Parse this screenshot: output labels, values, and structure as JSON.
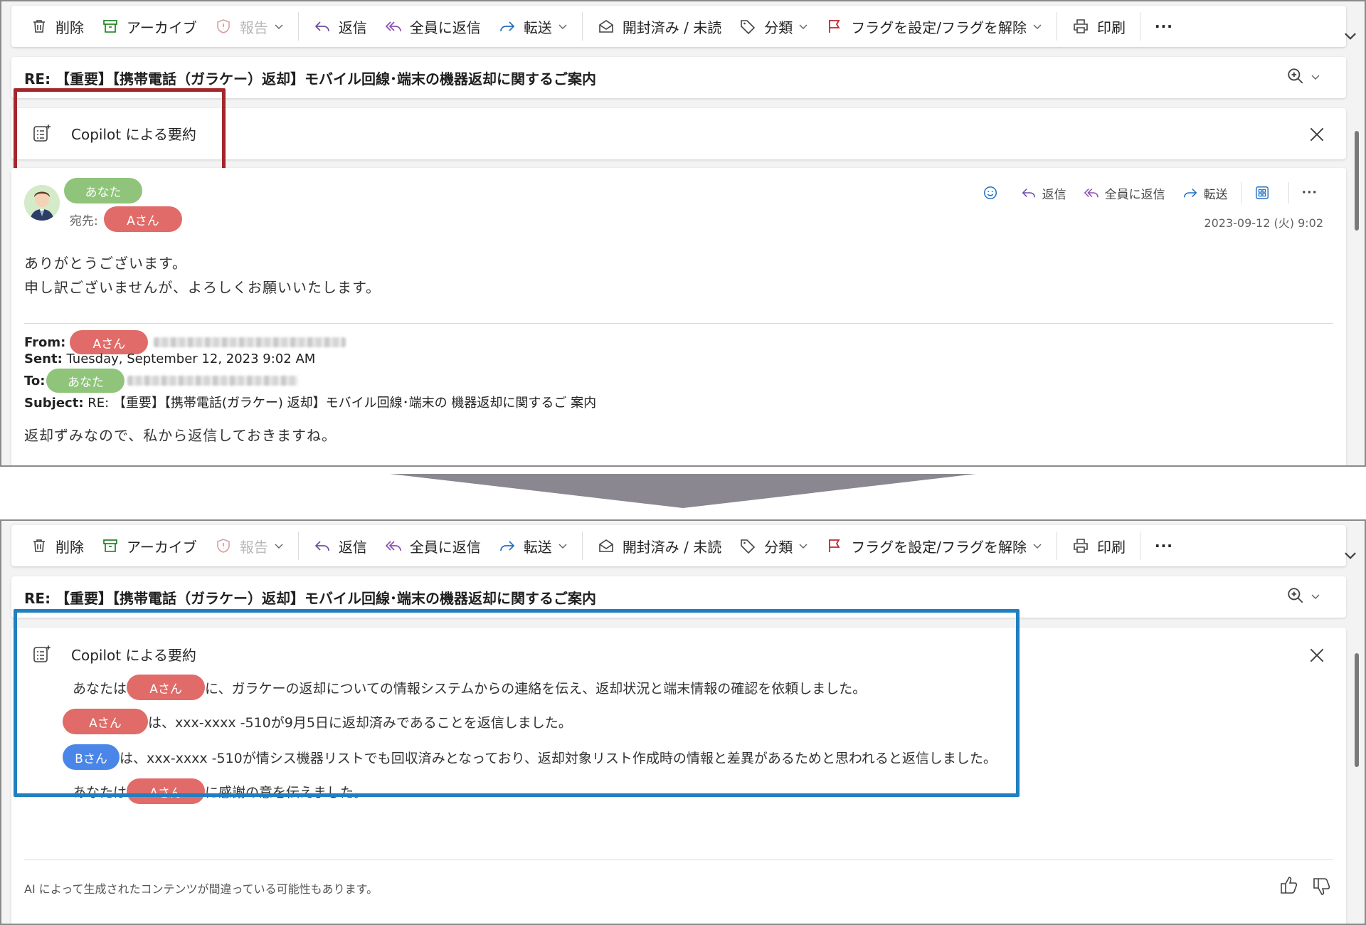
{
  "toolbar": {
    "delete": "削除",
    "archive": "アーカイブ",
    "report": "報告",
    "reply": "返信",
    "reply_all": "全員に返信",
    "forward": "転送",
    "read_unread": "開封済み / 未読",
    "categorize": "分類",
    "flag": "フラグを設定/フラグを解除",
    "print": "印刷",
    "more": "···"
  },
  "subject": "RE: 【重要】【携帯電話（ガラケー）返却】モバイル回線･端末の機器返却に関するご案内",
  "copilot": {
    "title": "Copilot による要約",
    "summary": [
      {
        "before": "あなたは",
        "pill": "Aさん",
        "pill_color": "red",
        "after": "に、ガラケーの返却についての情報システムからの連絡を伝え、返却状況と端末情報の確認を依頼しました。"
      },
      {
        "before": "",
        "pill": "Aさん",
        "pill_color": "red",
        "after": "は、xxx-xxxx -510が9月5日に返却済みであることを返信しました。"
      },
      {
        "before": "",
        "pill": "Bさん",
        "pill_color": "blue",
        "after": "は、xxx-xxxx -510が情シス機器リストでも回収済みとなっており、返却対象リスト作成時の情報と差異があるためと思われると返信しました。"
      },
      {
        "before": "あなたは",
        "pill": "Aさん",
        "pill_color": "red",
        "after": "に感謝の意を伝えました。"
      }
    ],
    "disclaimer": "AI によって生成されたコンテンツが間違っている可能性もあります。"
  },
  "email": {
    "sender": "あなた",
    "to_label": "宛先:",
    "recipient": "Aさん",
    "actions": {
      "reply": "返信",
      "reply_all": "全員に返信",
      "forward": "転送",
      "more": "···"
    },
    "date": "2023-09-12 (火) 9:02",
    "body_lines": [
      "ありがとうございます。",
      "申し訳ございませんが、よろしくお願いいたします。"
    ],
    "quoted": {
      "from_label": "From:",
      "from_name": "Aさん",
      "sent_label": "Sent:",
      "sent_value": "Tuesday, September 12, 2023 9:02 AM",
      "to_label": "To:",
      "to_name": "あなた",
      "subject_label": "Subject:",
      "subject_value": "RE: 【重要】【携帯電話(ガラケー) 返却】モバイル回線･端末の 機器返却に関するご 案内",
      "body": "返却ずみなので、私から返信しておきますね。"
    }
  },
  "colors": {
    "highlight_red": "#a4262c",
    "highlight_blue": "#1f7fc0",
    "pill_green": "#8fc47a",
    "pill_red": "#e06b68",
    "pill_blue": "#4a86e8"
  }
}
